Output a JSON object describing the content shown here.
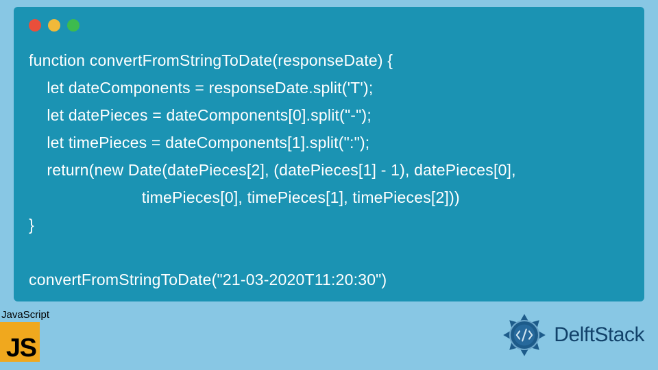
{
  "window": {
    "dots": [
      "red",
      "yellow",
      "green"
    ]
  },
  "code": {
    "lines": [
      "function convertFromStringToDate(responseDate) {",
      "    let dateComponents = responseDate.split('T');",
      "    let datePieces = dateComponents[0].split(\"-\");",
      "    let timePieces = dateComponents[1].split(\":\");",
      "    return(new Date(datePieces[2], (datePieces[1] - 1), datePieces[0],",
      "                         timePieces[0], timePieces[1], timePieces[2]))",
      "}",
      "",
      "convertFromStringToDate(\"21-03-2020T11:20:30\")"
    ]
  },
  "badges": {
    "js_label": "JavaScript",
    "js_j": "J",
    "js_s": "S",
    "delft_text": "DelftStack"
  },
  "colors": {
    "page_bg": "#88c7e4",
    "window_bg": "#1b93b3",
    "code_text": "#ffffff",
    "js_bg": "#f0a81e",
    "delft_text": "#12426a"
  }
}
